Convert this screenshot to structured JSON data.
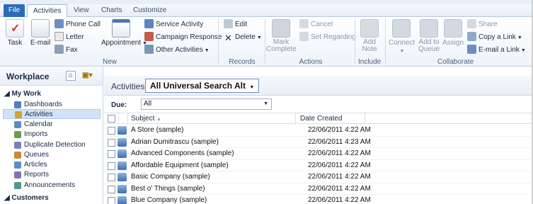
{
  "tabs": {
    "file": "File",
    "activities": "Activities",
    "view": "View",
    "charts": "Charts",
    "customize": "Customize"
  },
  "ribbon": {
    "new": {
      "label": "New",
      "task": "Task",
      "email": "E-mail",
      "phone_call": "Phone Call",
      "letter": "Letter",
      "fax": "Fax",
      "appointment": "Appointment",
      "service_activity": "Service Activity",
      "campaign_response": "Campaign Response",
      "other_activities": "Other Activities"
    },
    "records": {
      "label": "Records",
      "edit": "Edit",
      "delete": "Delete"
    },
    "actions": {
      "label": "Actions",
      "mark_complete": "Mark Complete",
      "cancel": "Cancel",
      "set_regarding": "Set Regarding"
    },
    "include": {
      "label": "Include",
      "add_note": "Add Note"
    },
    "collaborate": {
      "label": "Collaborate",
      "connect": "Connect",
      "add_to_queue": "Add to Queue",
      "assign": "Assign",
      "share": "Share",
      "copy_link": "Copy a Link",
      "email_link": "E-mail a Link"
    }
  },
  "sidebar": {
    "title": "Workplace",
    "my_work": "My Work",
    "items": [
      {
        "label": "Dashboards",
        "color": "#4a7fc1"
      },
      {
        "label": "Activities",
        "color": "#d3a52b"
      },
      {
        "label": "Calendar",
        "color": "#5a8dd0"
      },
      {
        "label": "Imports",
        "color": "#6f9a4a"
      },
      {
        "label": "Duplicate Detection",
        "color": "#7a7fbf"
      },
      {
        "label": "Queues",
        "color": "#c98a3a"
      },
      {
        "label": "Articles",
        "color": "#5a8dd0"
      },
      {
        "label": "Reports",
        "color": "#8a6fb8"
      },
      {
        "label": "Announcements",
        "color": "#4a9a8a"
      }
    ],
    "customers": "Customers"
  },
  "main": {
    "view_label": "Activities:",
    "view_selected": "All Universal Search Alt",
    "due_label": "Due:",
    "due_value": "All",
    "columns": {
      "subject": "Subject",
      "date_created": "Date Created"
    },
    "rows": [
      {
        "subject": "A Store (sample)",
        "date": "22/06/2011 4:22 AM"
      },
      {
        "subject": "Adrian Dumitrascu (sample)",
        "date": "22/06/2011 4:23 AM"
      },
      {
        "subject": "Advanced Components (sample)",
        "date": "22/06/2011 4:22 AM"
      },
      {
        "subject": "Affordable Equipment (sample)",
        "date": "22/06/2011 4:22 AM"
      },
      {
        "subject": "Basic Company (sample)",
        "date": "22/06/2011 4:22 AM"
      },
      {
        "subject": "Best o' Things (sample)",
        "date": "22/06/2011 4:22 AM"
      },
      {
        "subject": "Blue Company (sample)",
        "date": "22/06/2011 4:22 AM"
      }
    ]
  }
}
